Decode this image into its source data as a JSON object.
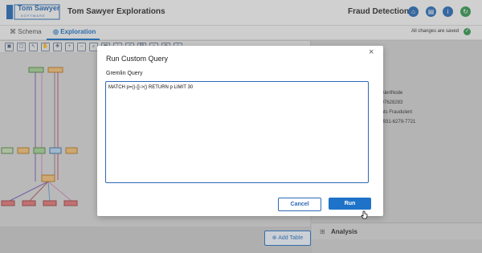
{
  "header": {
    "brand_top": "Tom Sawyer",
    "brand_bottom": "SOFTWARE",
    "app_title": "Tom Sawyer Explorations",
    "section_title": "Fraud Detection",
    "icons": [
      "home-icon",
      "document-icon",
      "info-icon",
      "refresh-icon"
    ]
  },
  "tabs": [
    {
      "label": "Schema",
      "icon": "schema-icon"
    },
    {
      "label": "Exploration",
      "icon": "compass-icon"
    }
  ],
  "save_status": "All changes are saved",
  "toolbar": {
    "icons": [
      "save-icon",
      "doc-icon",
      "select-icon",
      "pan-icon",
      "move-icon",
      "zoom-in-icon",
      "zoom-out-icon",
      "search-icon",
      "fit-icon",
      "layout-icon",
      "grid-icon",
      "link-icon",
      "delete-icon",
      "settings-icon",
      "export-icon"
    ]
  },
  "right_panel": {
    "properties": [
      "e",
      "edAlertNode",
      "4297628283",
      "ounts Fraudulent",
      "5-3931-6279-7721"
    ],
    "analysis_label": "Analysis"
  },
  "add_table_label": "Add Table",
  "dialog": {
    "title": "Run Custom Query",
    "close_label": "×",
    "query_label": "Gremlin Query",
    "query_text": "MATCH p=()-[]->() RETURN p LIMIT 30",
    "cancel_label": "Cancel",
    "run_label": "Run"
  },
  "colors": {
    "accent": "#1e73c8",
    "success": "#3a9a58",
    "overlay": "rgba(80,80,80,0.22)"
  }
}
